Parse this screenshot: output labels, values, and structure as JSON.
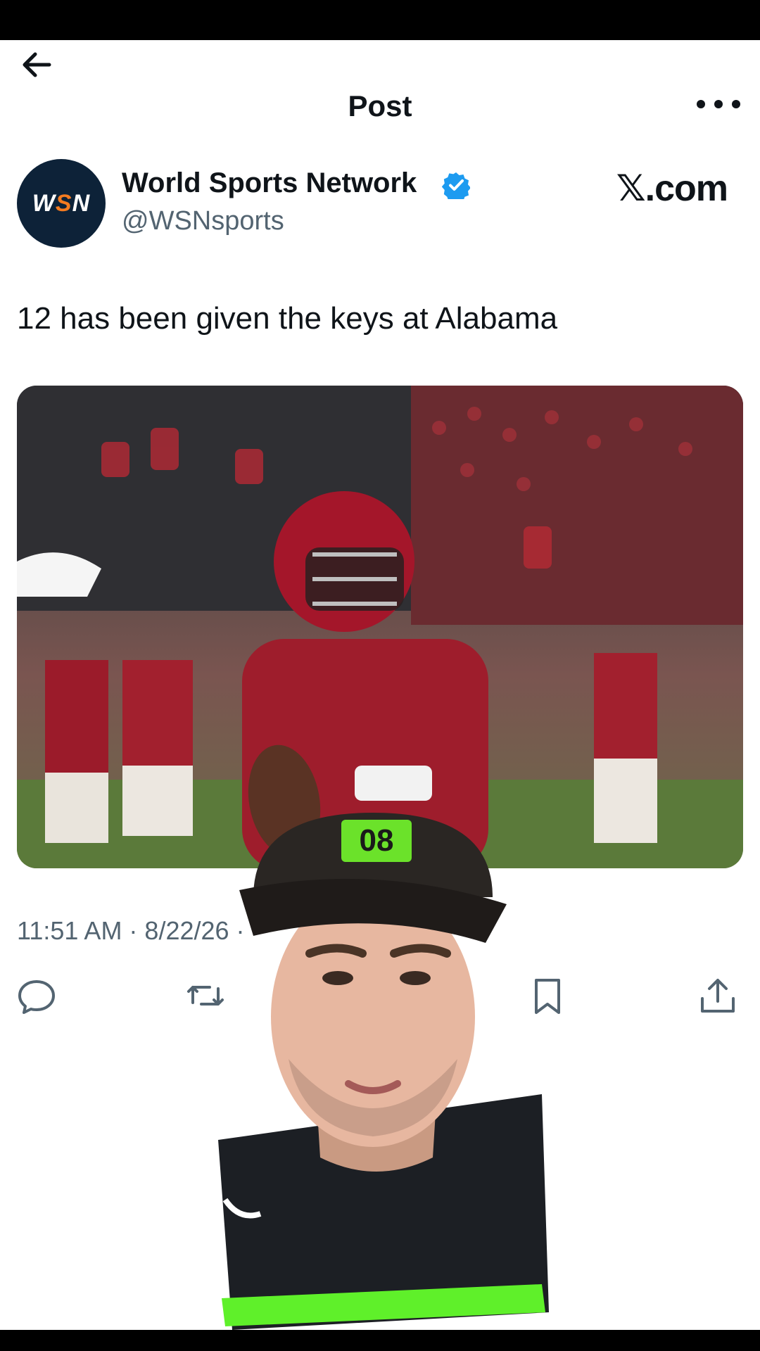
{
  "header": {
    "title": "Post",
    "back_icon": "arrow-left-icon",
    "more_icon": "more-horizontal-icon"
  },
  "author": {
    "avatar_text": "WSN",
    "display_name": "World Sports Network",
    "handle": "@WSNsports",
    "verified": true
  },
  "watermark": "𝕏.com",
  "post": {
    "text": "12 has been given the keys at Alabama",
    "timestamp": "11:51 AM · 8/22/26 ·"
  },
  "actions": [
    {
      "icon": "reply-icon"
    },
    {
      "icon": "repost-icon"
    },
    {
      "icon": "bookmark-icon"
    },
    {
      "icon": "share-icon"
    }
  ],
  "colors": {
    "verified": "#1d9bf0",
    "muted": "#536471",
    "text": "#0f1419",
    "avatar_bg": "#0d2238"
  },
  "overlay": {
    "cap_badge": "08"
  }
}
